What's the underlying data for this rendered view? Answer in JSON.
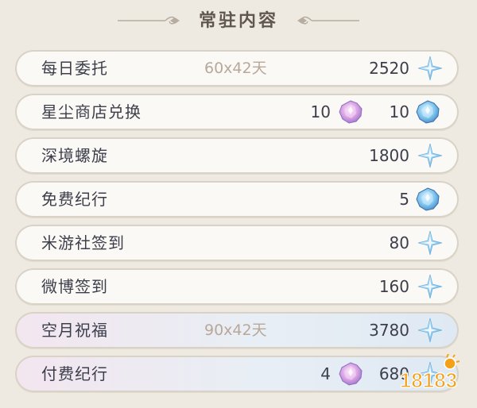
{
  "header": {
    "title": "常驻内容"
  },
  "rows": [
    {
      "name": "每日委托",
      "days": "60x42天",
      "amount": "2520",
      "icon": "primogem-icon"
    },
    {
      "name": "星尘商店兑换",
      "amount_left": "10",
      "icon_left": "pink-fate-icon",
      "amount": "10",
      "icon": "blue-fate-icon"
    },
    {
      "name": "深境螺旋",
      "amount": "1800",
      "icon": "primogem-icon"
    },
    {
      "name": "免费纪行",
      "amount": "5",
      "icon": "blue-fate-icon"
    },
    {
      "name": "米游社签到",
      "amount": "80",
      "icon": "primogem-icon"
    },
    {
      "name": "微博签到",
      "amount": "160",
      "icon": "primogem-icon"
    },
    {
      "name": "空月祝福",
      "days": "90x42天",
      "amount": "3780",
      "icon": "primogem-icon"
    },
    {
      "name": "付费纪行",
      "amount_left": "4",
      "icon_left": "pink-fate-icon",
      "amount": "680",
      "icon": "primogem-icon"
    }
  ],
  "watermark": {
    "text": "18183"
  },
  "colors": {
    "background": "#efeae1",
    "row_bg": "#fbf9f5",
    "row_border": "#d9d2c6",
    "highlight_bg": "#e8eef5",
    "days_text": "#b8a89a"
  }
}
